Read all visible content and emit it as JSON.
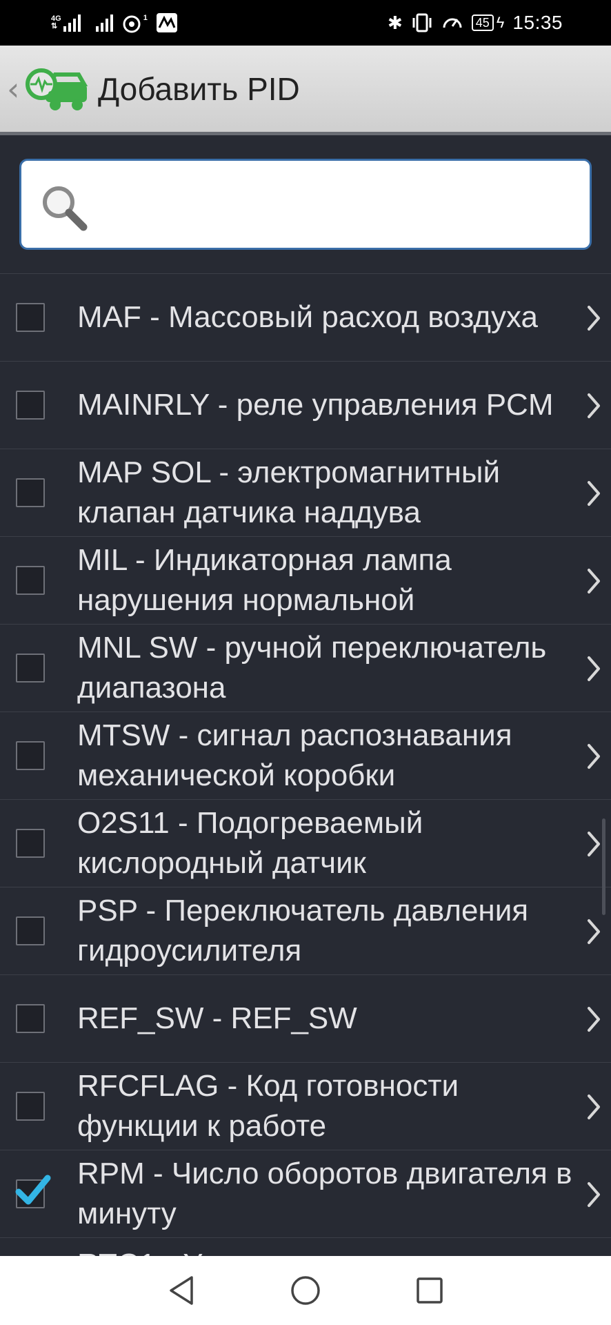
{
  "status_bar": {
    "network_a": "4G",
    "network_sup": "1",
    "battery": "45",
    "time": "15:35"
  },
  "header": {
    "back_label": "‹",
    "title": "Добавить PID"
  },
  "search": {
    "value": "",
    "placeholder": ""
  },
  "list": {
    "items": [
      {
        "label": "MAF - Массовый расход воздуха",
        "checked": false
      },
      {
        "label": "MAINRLY - реле управления PCM",
        "checked": false
      },
      {
        "label": "MAP SOL - электромагнитный клапан датчика наддува",
        "checked": false
      },
      {
        "label": "MIL - Индикаторная лампа нарушения нормальной",
        "checked": false
      },
      {
        "label": "MNL SW - ручной переключатель диапазона",
        "checked": false
      },
      {
        "label": "MTSW - сигнал распознавания механической коробки",
        "checked": false
      },
      {
        "label": "O2S11 - Подогреваемый кислородный датчик",
        "checked": false
      },
      {
        "label": "PSP - Переключатель давления гидроусилителя",
        "checked": false
      },
      {
        "label": "REF_SW - REF_SW",
        "checked": false
      },
      {
        "label": "RFCFLAG - Код готовности функции к работе",
        "checked": false
      },
      {
        "label": "RPM - Число оборотов двигателя в минуту",
        "checked": true
      }
    ],
    "next_partial": "RTC1 - У"
  },
  "colors": {
    "list_bg": "#272a33",
    "accent_green": "#4caf50",
    "check_blue": "#33b5e5"
  }
}
